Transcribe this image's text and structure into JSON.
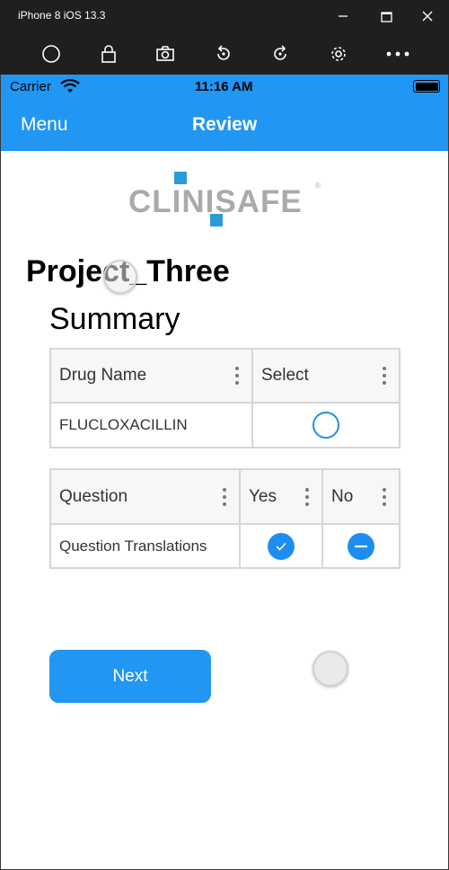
{
  "window": {
    "title": "iPhone 8 iOS 13.3",
    "controls": [
      "minimize-icon",
      "maximize-icon",
      "close-icon"
    ]
  },
  "toolbar": {
    "buttons": [
      "home-icon",
      "lock-icon",
      "screenshot-icon",
      "rotate-left-icon",
      "rotate-right-icon",
      "settings-icon",
      "more-icon"
    ]
  },
  "statusbar": {
    "carrier": "Carrier",
    "time": "11:16 AM"
  },
  "navbar": {
    "menu_label": "Menu",
    "title": "Review"
  },
  "logo": {
    "text": "CLINISAFE",
    "mark": "®"
  },
  "project": {
    "title": "Project_Three",
    "subtitle": "Summary"
  },
  "drug_table": {
    "headers": [
      "Drug Name",
      "Select"
    ],
    "rows": [
      {
        "drug": "FLUCLOXACILLIN",
        "selected": false
      }
    ]
  },
  "question_table": {
    "headers": [
      "Question",
      "Yes",
      "No"
    ],
    "rows": [
      {
        "question": "Question Translations",
        "yes": "checked",
        "no": "indeterminate"
      }
    ]
  },
  "actions": {
    "next_label": "Next"
  },
  "colors": {
    "accent": "#2196f3",
    "radio": "#1d8ef0",
    "chrome": "#1f1f1f",
    "logo_gray": "#a8aaac",
    "logo_blue": "#2b9ad9"
  }
}
